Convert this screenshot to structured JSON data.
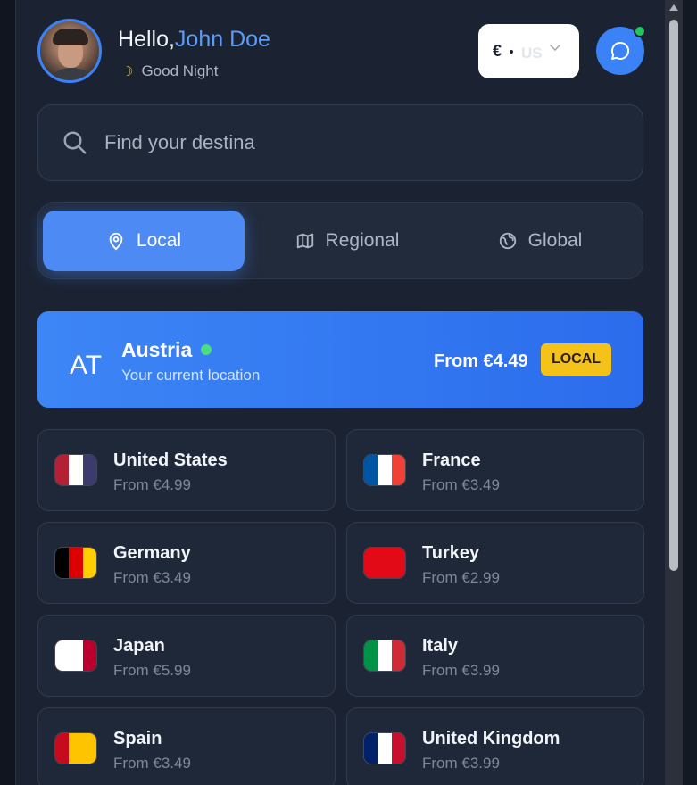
{
  "header": {
    "greeting": "Hello,",
    "user_name": "John Doe",
    "time_greeting": "Good Night",
    "moon_icon": "☽"
  },
  "currency": {
    "symbol": "€",
    "code": "US"
  },
  "search": {
    "placeholder": "Find your destina"
  },
  "tabs": [
    {
      "label": "Local",
      "icon": "location-pin-icon",
      "active": true
    },
    {
      "label": "Regional",
      "icon": "map-icon",
      "active": false
    },
    {
      "label": "Global",
      "icon": "globe-icon",
      "active": false
    }
  ],
  "current_location": {
    "code": "AT",
    "country": "Austria",
    "subtitle": "Your current location",
    "price": "From €4.49",
    "badge": "LOCAL"
  },
  "destinations": [
    {
      "name": "United States",
      "price": "From €4.99",
      "flag": [
        "#b22234",
        "#ffffff",
        "#3c3b6e"
      ]
    },
    {
      "name": "France",
      "price": "From €3.49",
      "flag": [
        "#0055a4",
        "#ffffff",
        "#ef4135"
      ]
    },
    {
      "name": "Germany",
      "price": "From €3.49",
      "flag": [
        "#000000",
        "#dd0000",
        "#ffce00"
      ]
    },
    {
      "name": "Turkey",
      "price": "From €2.99",
      "flag": [
        "#e30a17",
        "#e30a17",
        "#e30a17"
      ]
    },
    {
      "name": "Japan",
      "price": "From €5.99",
      "flag": [
        "#ffffff",
        "#ffffff",
        "#bc002d"
      ]
    },
    {
      "name": "Italy",
      "price": "From €3.99",
      "flag": [
        "#009246",
        "#ffffff",
        "#ce2b37"
      ]
    },
    {
      "name": "Spain",
      "price": "From €3.49",
      "flag": [
        "#c60b1e",
        "#ffc400",
        "#ffc400"
      ]
    },
    {
      "name": "United Kingdom",
      "price": "From €3.99",
      "flag": [
        "#012169",
        "#ffffff",
        "#c8102e"
      ]
    }
  ],
  "colors": {
    "accent": "#3b82f6",
    "panel": "#1b2332",
    "badge": "#f5c21a",
    "online": "#22c55e"
  }
}
